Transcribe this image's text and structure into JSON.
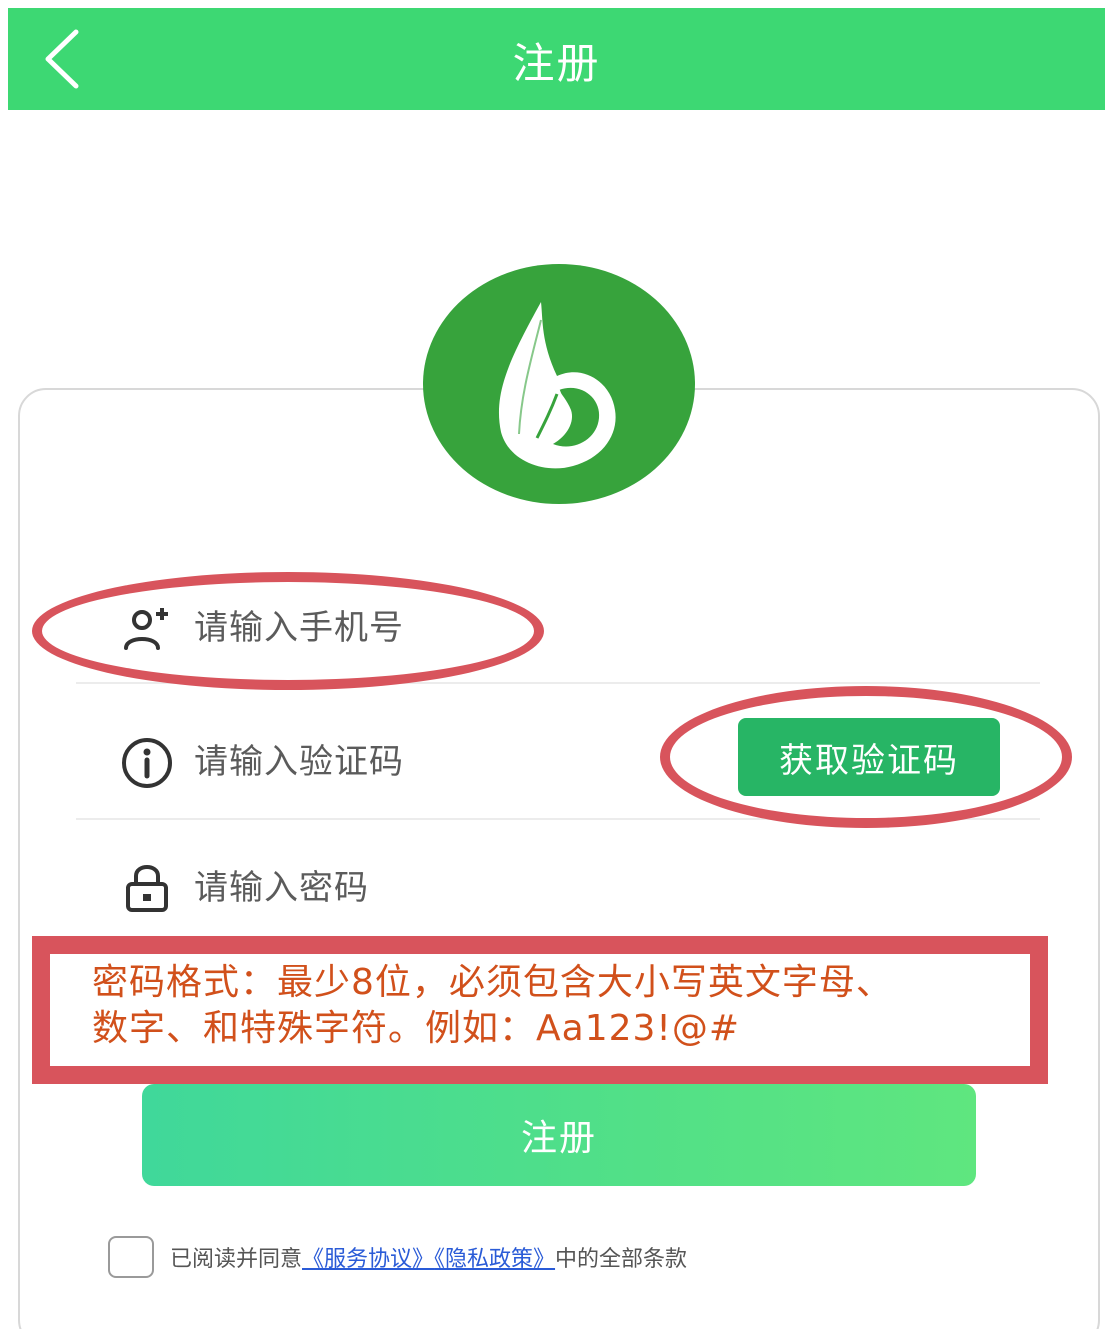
{
  "header": {
    "title": "注册",
    "back_icon": "chevron-left-icon",
    "color": "#3dd873"
  },
  "logo": {
    "icon": "leaf-drop-logo",
    "color": "#37a33c"
  },
  "form": {
    "phone": {
      "placeholder": "请输入手机号",
      "icon": "add-user-icon"
    },
    "code": {
      "placeholder": "请输入验证码",
      "icon": "info-circle-icon",
      "button_label": "获取验证码"
    },
    "password": {
      "placeholder": "请输入密码",
      "icon": "lock-icon"
    },
    "password_hint_line1": "密码格式：最少8位，必须包含大小写英文字母、",
    "password_hint_line2": "数字、和特殊字符。例如：Aa123!@#",
    "submit_label": "注册"
  },
  "agreement": {
    "prefix": "已阅读并同意",
    "service_link": "《服务协议》",
    "privacy_link": "《隐私政策》",
    "suffix": "中的全部条款",
    "checked": false
  },
  "annotation_color": "#d8545c",
  "hint_color": "#d1501b"
}
